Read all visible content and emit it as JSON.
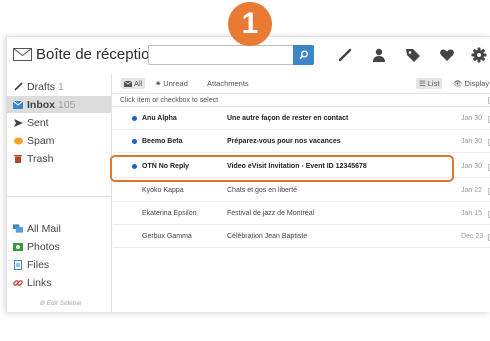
{
  "step_badge": "1",
  "header": {
    "title": "Boîte de réception",
    "search": {
      "value": "",
      "placeholder": ""
    }
  },
  "sidebar": {
    "items": [
      {
        "label": "Drafts",
        "count": "1",
        "icon": "pencil-icon"
      },
      {
        "label": "Inbox",
        "count": "105",
        "icon": "inbox-icon",
        "active": true
      },
      {
        "label": "Sent",
        "count": "",
        "icon": "send-icon"
      },
      {
        "label": "Spam",
        "count": "",
        "icon": "spam-icon"
      },
      {
        "label": "Trash",
        "count": "",
        "icon": "trash-icon"
      },
      {
        "label": "All Mail",
        "count": "",
        "icon": "all-mail-icon"
      },
      {
        "label": "Photos",
        "count": "",
        "icon": "photo-icon"
      },
      {
        "label": "Files",
        "count": "",
        "icon": "file-icon"
      },
      {
        "label": "Links",
        "count": "",
        "icon": "link-icon"
      }
    ],
    "edit_label": "Edit Sidebar"
  },
  "toolbar": {
    "all": "All",
    "unread": "Unread",
    "attachments": "Attachments",
    "list": "List",
    "display": "Display"
  },
  "hint": "Click item or checkbox to select",
  "messages": [
    {
      "sender": "Anu Alpha",
      "subject": "Une autre façon de rester en contact",
      "date": "Jan 30",
      "unread": true
    },
    {
      "sender": "Beemo Beta",
      "subject": "Préparez-vous pour nos vacances",
      "date": "Jan 30",
      "unread": true
    },
    {
      "sender": "OTN No Reply",
      "subject": "Video eVisit Invitation - Event ID 12345678",
      "date": "Jan 30",
      "unread": true,
      "highlighted": true
    },
    {
      "sender": "Kyoko Kappa",
      "subject": "Chats et gos en liberté",
      "date": "Jan 22",
      "unread": false
    },
    {
      "sender": "Ekaterina Epsilon",
      "subject": "Festival de jazz de Montréal",
      "date": "Jan 15",
      "unread": false
    },
    {
      "sender": "Gerbux Gamma",
      "subject": "Célébration Jean Baptiste",
      "date": "Dec 23",
      "unread": false
    }
  ],
  "colors": {
    "accent": "#3c85c7",
    "highlight": "#e0752d",
    "unread_dot": "#1a5fd6"
  }
}
